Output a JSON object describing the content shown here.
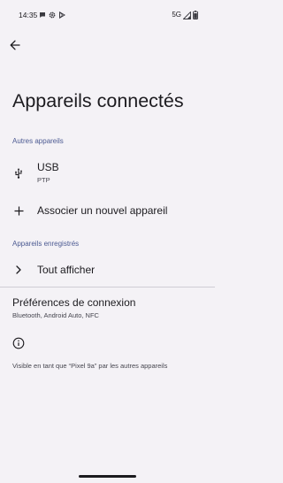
{
  "status_bar": {
    "time": "14:35",
    "network": "5G",
    "left_icons": [
      "chat-bubble-icon",
      "gear-icon",
      "play-store-icon"
    ],
    "right_icons": [
      "signal-icon",
      "battery-icon"
    ]
  },
  "header": {
    "back_icon": "arrow-left-icon",
    "title": "Appareils connectés"
  },
  "sections": {
    "other_devices": {
      "header": "Autres appareils",
      "usb": {
        "icon": "usb-icon",
        "title": "USB",
        "subtitle": "PTP"
      },
      "pair": {
        "icon": "plus-icon",
        "title": "Associer un nouvel appareil"
      }
    },
    "saved_devices": {
      "header": "Appareils enregistrés",
      "see_all": {
        "icon": "chevron-right-icon",
        "title": "Tout afficher"
      }
    }
  },
  "preferences": {
    "title": "Préférences de connexion",
    "summary": "Bluetooth, Android Auto, NFC"
  },
  "footer": {
    "icon": "info-icon",
    "text": "Visible en tant que “Pixel 9a” par les autres appareils"
  },
  "colors": {
    "background": "#f4f2f6",
    "section_header": "#4c5a92",
    "text_primary": "#1c1b1f",
    "text_secondary": "#46464f"
  }
}
